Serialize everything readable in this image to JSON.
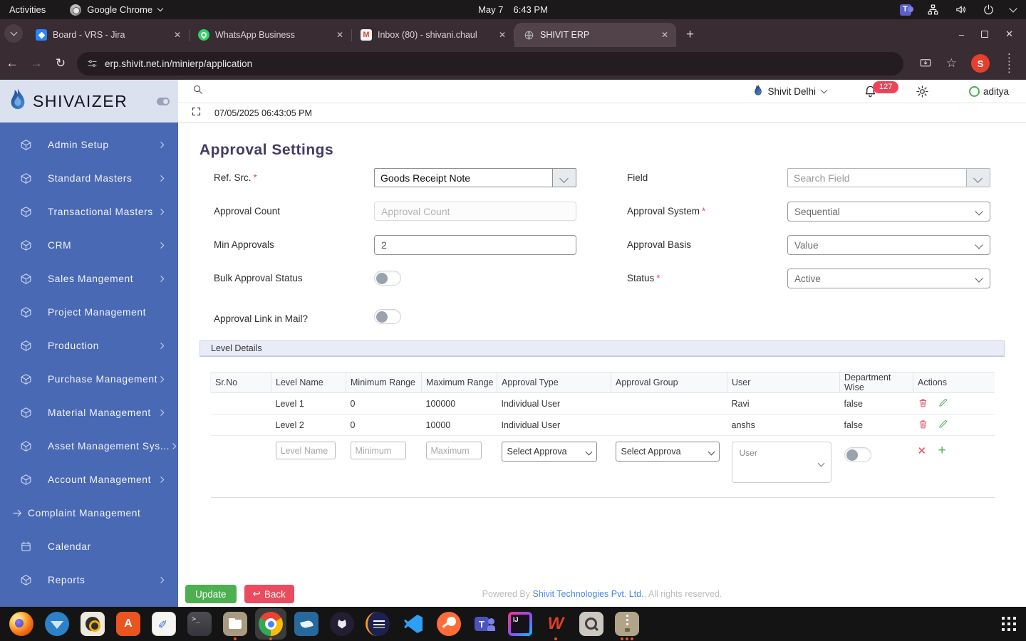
{
  "colors": {
    "sidebar_blue": "#4a69b4",
    "update_green": "#4caf50",
    "back_red": "#eb4b5e",
    "badge_red": "#f0435a",
    "link_blue": "#4a86e8",
    "avatar_orange": "#e5402d"
  },
  "system_bar": {
    "activities_label": "Activities",
    "app_menu_label": "Google Chrome",
    "date_label": "May 7",
    "time_label": "6:43 PM"
  },
  "browser": {
    "tabs": [
      {
        "title": "Board - VRS - Jira",
        "icon": "jira-icon",
        "active": false
      },
      {
        "title": "WhatsApp Business",
        "icon": "whatsapp-icon",
        "active": false
      },
      {
        "title": "Inbox (80) - shivani.chaul",
        "icon": "gmail-icon",
        "active": false
      },
      {
        "title": "SHIVIT ERP",
        "icon": "globe-icon",
        "active": true
      }
    ],
    "url": "erp.shivit.net.in/minierp/application",
    "profile_initial": "S"
  },
  "sidebar": {
    "brand": "SHIVAIZER",
    "items": [
      {
        "label": "Admin Setup",
        "icon": "cube-icon",
        "chevron": true
      },
      {
        "label": "Standard Masters",
        "icon": "cube-icon",
        "chevron": true
      },
      {
        "label": "Transactional Masters",
        "icon": "cube-icon",
        "chevron": true
      },
      {
        "label": "CRM",
        "icon": "cube-icon",
        "chevron": true
      },
      {
        "label": "Sales Mangement",
        "icon": "cube-icon",
        "chevron": true
      },
      {
        "label": "Project Management",
        "icon": "cube-icon",
        "chevron": false
      },
      {
        "label": "Production",
        "icon": "cube-icon",
        "chevron": true
      },
      {
        "label": "Purchase Management",
        "icon": "cube-icon",
        "chevron": true
      },
      {
        "label": "Material Management",
        "icon": "cube-icon",
        "chevron": true
      },
      {
        "label": "Asset Management Sys...",
        "icon": "cube-icon",
        "chevron": true
      },
      {
        "label": "Account Management",
        "icon": "cube-icon",
        "chevron": true
      },
      {
        "label": "Complaint Management",
        "icon": "arrow-right-icon",
        "chevron": false
      },
      {
        "label": "Calendar",
        "icon": "calendar-icon",
        "chevron": false
      },
      {
        "label": "Reports",
        "icon": "cube-icon",
        "chevron": true
      }
    ]
  },
  "header": {
    "org_label": "Shivit Delhi",
    "notification_count": "127",
    "user_label": "aditya",
    "timestamp": "07/05/2025 06:43:05 PM"
  },
  "page": {
    "title": "Approval Settings",
    "form": {
      "ref_src": {
        "label": "Ref. Src.",
        "required": "*",
        "value": "Goods Receipt Note"
      },
      "field": {
        "label": "Field",
        "placeholder": "Search Field"
      },
      "approval_count": {
        "label": "Approval Count",
        "placeholder": "Approval Count"
      },
      "approval_system": {
        "label": "Approval System",
        "required": "*",
        "value": "Sequential"
      },
      "min_approvals": {
        "label": "Min Approvals",
        "value": "2"
      },
      "approval_basis": {
        "label": "Approval Basis",
        "value": "Value"
      },
      "bulk_approval_status": {
        "label": "Bulk Approval Status",
        "state": "off"
      },
      "status": {
        "label": "Status",
        "required": "*",
        "value": "Active"
      },
      "approval_link_in_mail": {
        "label": "Approval Link in Mail?",
        "state": "off"
      }
    },
    "level_details": {
      "section_title": "Level Details",
      "columns": [
        "Sr.No",
        "Level Name",
        "Minimum Range",
        "Maximum Range",
        "Approval Type",
        "Approval Group",
        "User",
        "Department Wise",
        "Actions"
      ],
      "rows": [
        {
          "sr": "",
          "level_name": "Level 1",
          "min_range": "0",
          "max_range": "100000",
          "approval_type": "Individual User",
          "approval_group": "",
          "user": "Ravi",
          "department_wise": "false"
        },
        {
          "sr": "",
          "level_name": "Level 2",
          "min_range": "0",
          "max_range": "10000",
          "approval_type": "Individual User",
          "approval_group": "",
          "user": "anshs",
          "department_wise": "false"
        }
      ],
      "new_row": {
        "level_name_placeholder": "Level Name",
        "min_placeholder": "Minimum",
        "max_placeholder": "Maximum",
        "approval_type_placeholder": "Select Approva",
        "approval_group_placeholder": "Select Approva",
        "user_placeholder": "User"
      }
    },
    "footer": {
      "update_label": "Update",
      "back_label": "Back",
      "powered_prefix": "Powered By ",
      "powered_link": "Shivit Technologies Pvt. Ltd.",
      "powered_suffix": ", All rights reserved."
    }
  },
  "taskbar": {
    "icons": [
      {
        "name": "firefox"
      },
      {
        "name": "thunderbird"
      },
      {
        "name": "rhythmbox"
      },
      {
        "name": "ubuntu-software"
      },
      {
        "name": "text-editor"
      },
      {
        "name": "terminal"
      },
      {
        "name": "files",
        "dots": 1
      },
      {
        "name": "chrome",
        "dots": 1,
        "active": true
      },
      {
        "name": "mysql-workbench"
      },
      {
        "name": "github-desktop"
      },
      {
        "name": "eclipse"
      },
      {
        "name": "vscode"
      },
      {
        "name": "postman"
      },
      {
        "name": "teams"
      },
      {
        "name": "intellij"
      },
      {
        "name": "wps-office",
        "dots": 1
      },
      {
        "name": "screenshot-tool"
      },
      {
        "name": "archive-manager",
        "dots": 3
      }
    ]
  }
}
